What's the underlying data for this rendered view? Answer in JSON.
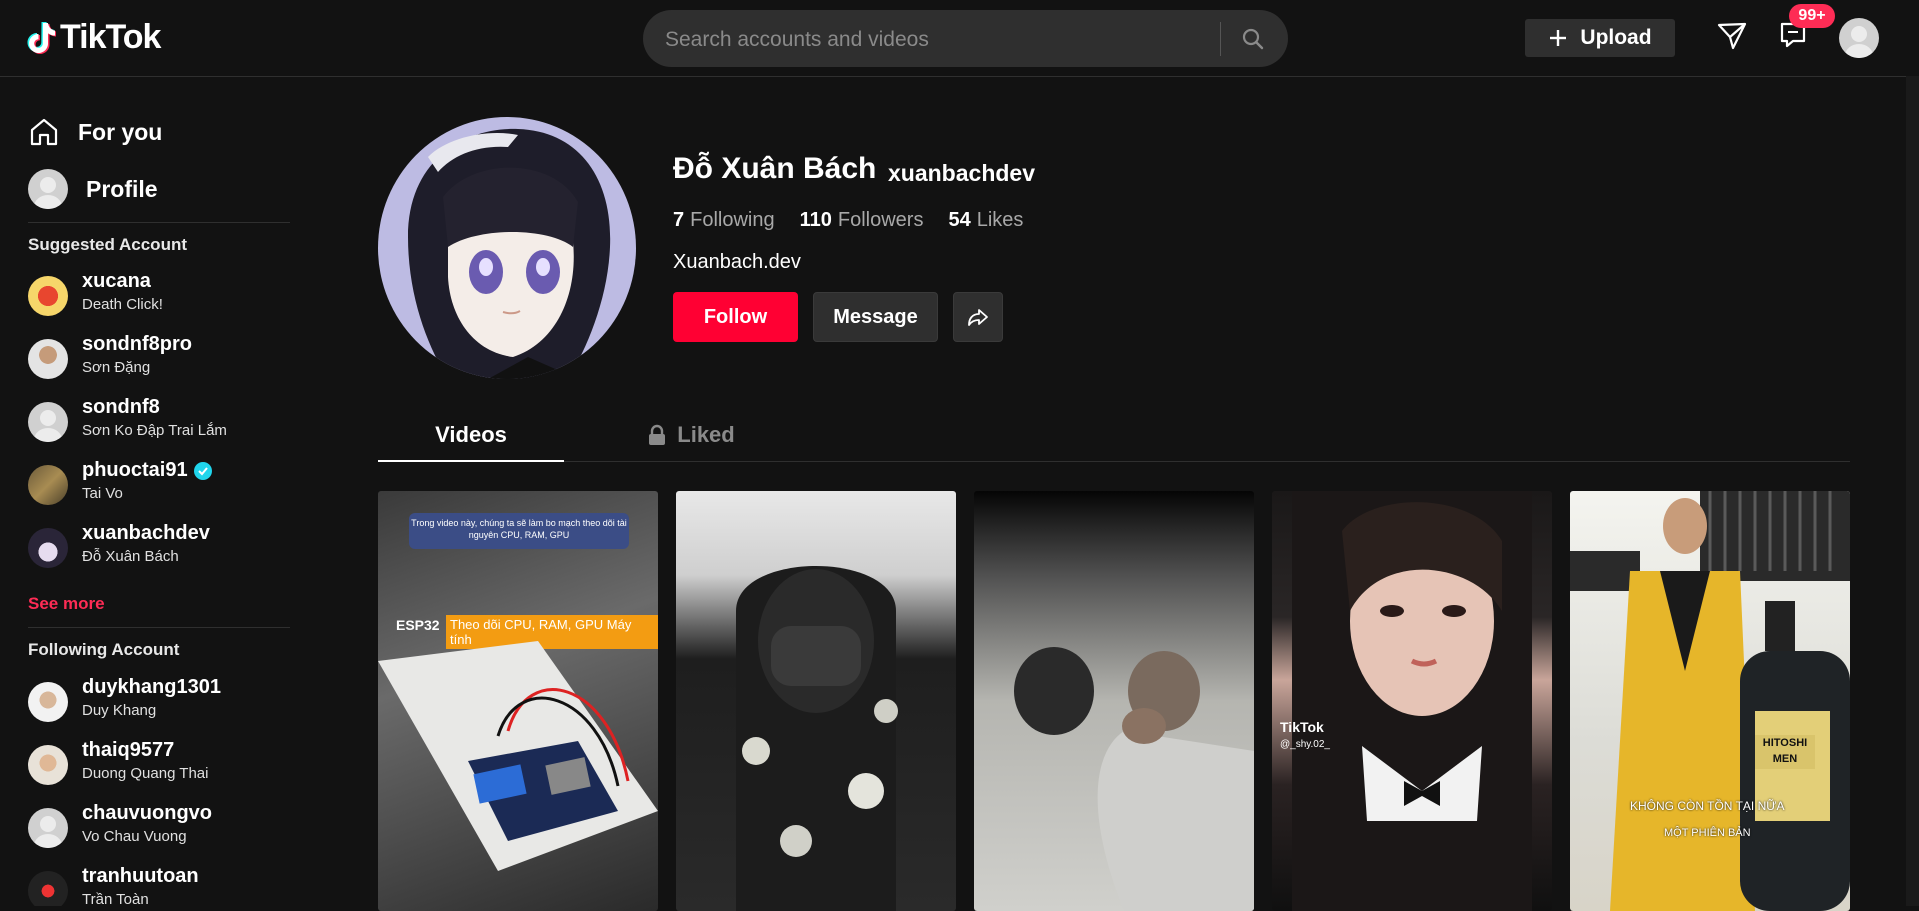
{
  "header": {
    "logo_text": "TikTok",
    "search_placeholder": "Search accounts and videos",
    "upload_label": "Upload",
    "inbox_badge": "99+"
  },
  "sidebar": {
    "nav": [
      {
        "label": "For you",
        "icon": "home-icon"
      },
      {
        "label": "Profile",
        "icon": "avatar"
      }
    ],
    "suggested_title": "Suggested Account",
    "suggested": [
      {
        "username": "xucana",
        "display_name": "Death Click!"
      },
      {
        "username": "sondnf8pro",
        "display_name": "Sơn Đặng"
      },
      {
        "username": "sondnf8",
        "display_name": "Sơn Ko Đập Trai Lắm"
      },
      {
        "username": "phuoctai91",
        "display_name": "Tai Vo",
        "verified": true
      },
      {
        "username": "xuanbachdev",
        "display_name": "Đỗ Xuân Bách"
      }
    ],
    "see_more": "See more",
    "following_title": "Following Account",
    "following": [
      {
        "username": "duykhang1301",
        "display_name": "Duy Khang"
      },
      {
        "username": "thaiq9577",
        "display_name": "Duong Quang Thai"
      },
      {
        "username": "chauvuongvo",
        "display_name": "Vo Chau Vuong"
      },
      {
        "username": "tranhuutoan",
        "display_name": "Trần Toàn"
      }
    ]
  },
  "profile": {
    "display_name": "Đỗ Xuân Bách",
    "handle": "xuanbachdev",
    "following_count": "7",
    "following_label": "Following",
    "followers_count": "110",
    "followers_label": "Followers",
    "likes_count": "54",
    "likes_label": "Likes",
    "bio": "Xuanbach.dev",
    "follow_label": "Follow",
    "message_label": "Message"
  },
  "tabs": {
    "videos": "Videos",
    "liked": "Liked"
  },
  "videos": {
    "v1_caption": "Trong video này, chúng ta sẽ làm bo mạch theo dõi tài nguyên CPU, RAM, GPU",
    "v1_label": "ESP32",
    "v1_highlight": "Theo dõi CPU, RAM, GPU Máy tính",
    "v4_watermark": "TikTok",
    "v4_user": "@_shy.02_",
    "v5_brand": "HITOSHI MEN",
    "v5_line1": "KHÔNG CÒN TỒN TẠI NỮA",
    "v5_line2": "MỘT PHIÊN BẢN"
  },
  "colors": {
    "accent": "#fe2c55",
    "follow_button": "#ff0033",
    "background": "#121212",
    "verified": "#20d5ec"
  }
}
